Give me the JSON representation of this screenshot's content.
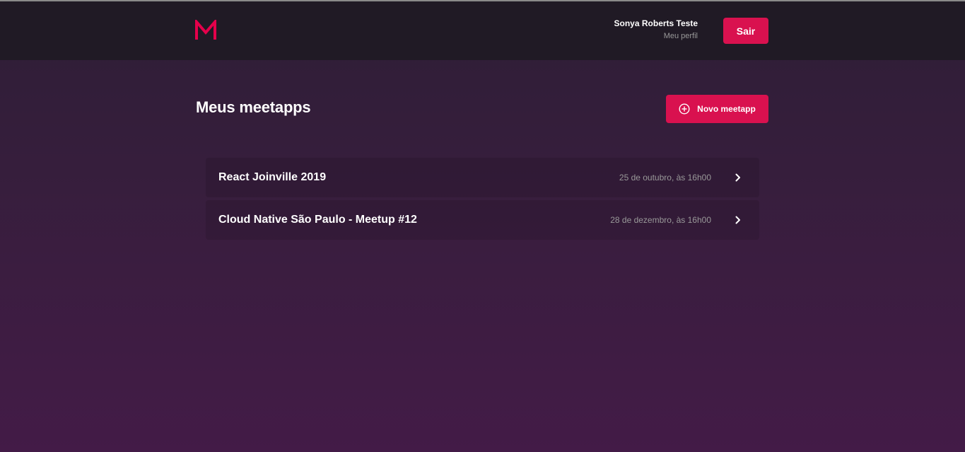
{
  "header": {
    "logo": {
      "icon": "meetapp-logo-icon",
      "letter": "M",
      "color": "#e5004b"
    },
    "user": {
      "name": "Sonya Roberts Teste",
      "profile_link": "Meu perfil"
    },
    "logout_label": "Sair"
  },
  "main": {
    "title": "Meus meetapps",
    "new_button": {
      "label": "Novo meetapp",
      "icon": "plus-circle-icon"
    },
    "meetups": [
      {
        "title": "React Joinville 2019",
        "date": "25 de outubro, às 16h00",
        "icon": "chevron-right-icon"
      },
      {
        "title": "Cloud Native São Paulo - Meetup #12",
        "date": "28 de dezembro, às 16h00",
        "icon": "chevron-right-icon"
      }
    ]
  },
  "colors": {
    "accent": "#d9114f",
    "header_bg": "#201a25",
    "background_top": "#2e1f36",
    "background_bottom": "#431b47",
    "muted_text": "#999999"
  }
}
